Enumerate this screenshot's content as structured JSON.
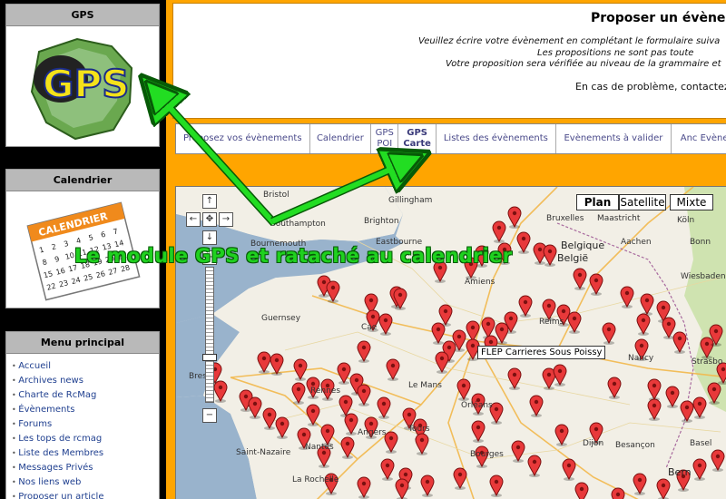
{
  "sidebar": {
    "gps_block": {
      "title": "GPS",
      "logo_text": "GPS"
    },
    "calendar_block": {
      "title": "Calendrier",
      "logo_text": "CALENDRIER"
    },
    "menu_block": {
      "title": "Menu principal",
      "items": [
        "Accueil",
        "Archives news",
        "Charte de RcMag",
        "Évènements",
        "Forums",
        "Les tops de rcmag",
        "Liste des Membres",
        "Messages Privés",
        "Nos liens web",
        "Proposer un article"
      ]
    }
  },
  "header": {
    "title": "Proposer un évène",
    "intro": [
      "Veuillez écrire votre évènement en complétant le formulaire suiva",
      "Les propositions ne sont pas toute",
      "Votre proposition sera vérifiée au niveau de la grammaire et"
    ],
    "contact": "En cas de problème, contactez"
  },
  "tabs": [
    {
      "label": "Proposez vos évènements"
    },
    {
      "label": "Calendrier"
    },
    {
      "label": "GPS POI"
    },
    {
      "label": "GPS Carte",
      "active": true
    },
    {
      "label": "Listes des évènements"
    },
    {
      "label": "Evènements à valider"
    },
    {
      "label": "Anc Evène"
    }
  ],
  "map": {
    "map_types": [
      "Plan",
      "Satellite",
      "Mixte"
    ],
    "selected_type": "Plan",
    "tooltip": "FLEP Carrieres Sous Poissy",
    "places": [
      "Bristol",
      "Southampton",
      "Bournemouth",
      "Gillingham",
      "Brighton",
      "Eastbourne",
      "Bruxelles",
      "Maastricht",
      "Köln",
      "Belgique",
      "België",
      "Aachen",
      "Bonn",
      "Wiesbaden",
      "Amiens",
      "Reims",
      "Guernsey",
      "Cae",
      "Le Mans",
      "Nancy",
      "Strasbo",
      "Brest",
      "Rennes",
      "Saint-Nazaire",
      "Nantes",
      "La Rochelle",
      "Angers",
      "Bourges",
      "Dijon",
      "Besançon",
      "Basel",
      "Bern",
      "Tours",
      "Orléans"
    ]
  },
  "annotation": "Le module GPS et rataché au calendrier"
}
